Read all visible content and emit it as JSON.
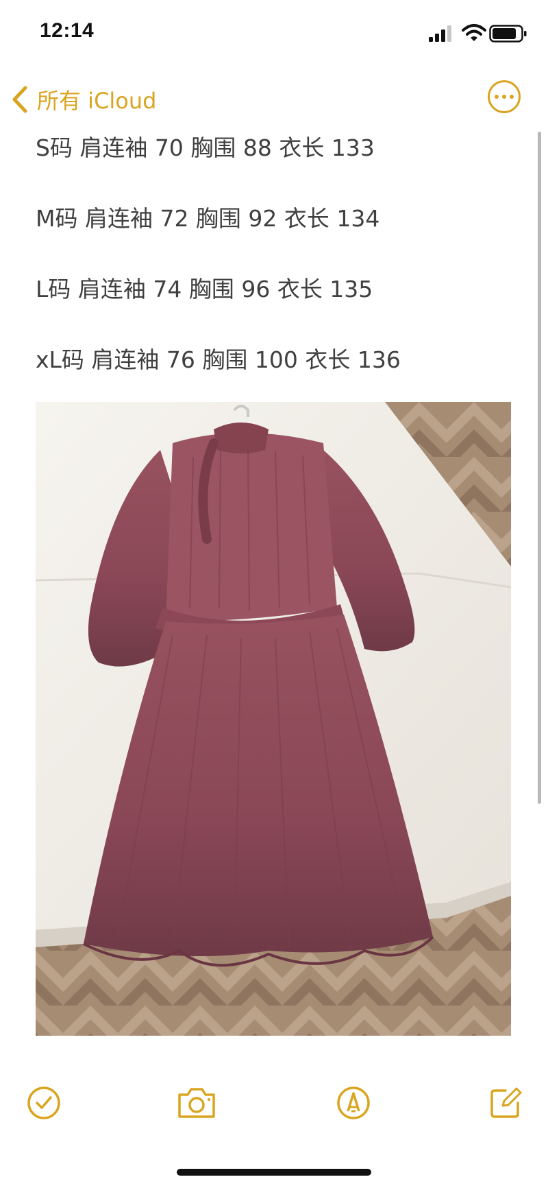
{
  "status_bar": {
    "time": "12:14"
  },
  "nav": {
    "back_label": "所有 iCloud",
    "back_icon": "chevron-left-icon",
    "more_icon": "ellipsis-circle-icon"
  },
  "note": {
    "lines": [
      "S码 肩连袖 70 胸围 88 衣长 133",
      "M码 肩连袖 72 胸围 92 衣长 134",
      "L码 肩连袖 74 胸围 96 衣长 135",
      "xL码 肩连袖 76 胸围 100 衣长 136"
    ]
  },
  "toolbar": {
    "items": [
      "checklist-icon",
      "camera-icon",
      "markup-icon",
      "compose-icon"
    ]
  },
  "colors": {
    "accent": "#d9a520",
    "text": "#3f3f3f",
    "dress": "#8e4a5a",
    "sofa": "#f2efe9",
    "floor": "#a48a72"
  }
}
